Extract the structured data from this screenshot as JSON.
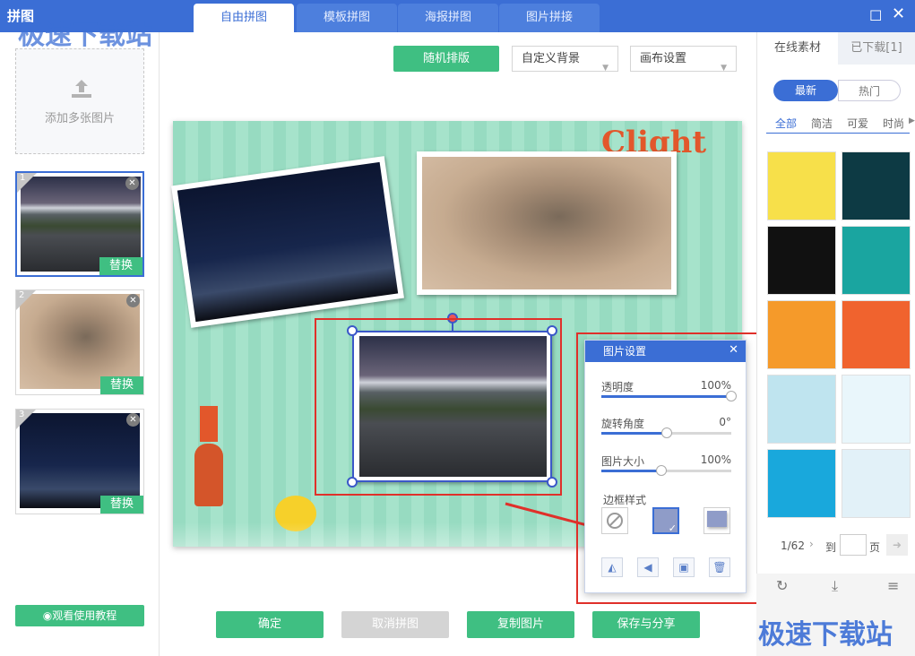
{
  "app": {
    "title": "拼图"
  },
  "tabs": [
    {
      "label": "自由拼图",
      "active": true
    },
    {
      "label": "模板拼图",
      "active": false
    },
    {
      "label": "海报拼图",
      "active": false
    },
    {
      "label": "图片拼接",
      "active": false
    }
  ],
  "window": {
    "maximize_icon": "maximize-icon",
    "close_icon": "close-icon"
  },
  "left": {
    "add_label": "添加多张图片",
    "add_icon": "upload-icon",
    "images": [
      {
        "index": "1",
        "replace": "替换"
      },
      {
        "index": "2",
        "replace": "替换"
      },
      {
        "index": "3",
        "replace": "替换"
      }
    ],
    "tutorial": "◉观看使用教程"
  },
  "toolbar": {
    "random": "随机排版",
    "background": "自定义背景",
    "canvas": "画布设置"
  },
  "canvas": {
    "deco_text": "Clight"
  },
  "settings": {
    "title": "图片设置",
    "opacity_label": "透明度",
    "opacity_value": "100%",
    "opacity_fraction": 1.0,
    "rotate_label": "旋转角度",
    "rotate_value": "0°",
    "rotate_fraction": 0.5,
    "size_label": "图片大小",
    "size_value": "100%",
    "size_fraction": 0.46,
    "border_label": "边框样式"
  },
  "bottom": {
    "confirm": "确定",
    "cancel": "取消拼图",
    "copy": "复制图片",
    "save": "保存与分享"
  },
  "right": {
    "tabs": [
      "在线素材",
      "已下载[1]"
    ],
    "filters": [
      "最新",
      "热门"
    ],
    "categories": [
      "全部",
      "简洁",
      "可爱",
      "时尚"
    ],
    "page_current": "1/62",
    "goto": "到",
    "page_unit": "页",
    "template_colors": [
      "#f7e04a",
      "#0d3a44",
      "#111111",
      "#1aa5a0",
      "#f59a2a",
      "#f0632e",
      "#bfe4ef",
      "#e9f6fb",
      "#19a8dc",
      "#e2f1f8"
    ]
  },
  "watermark": "极速下载站"
}
